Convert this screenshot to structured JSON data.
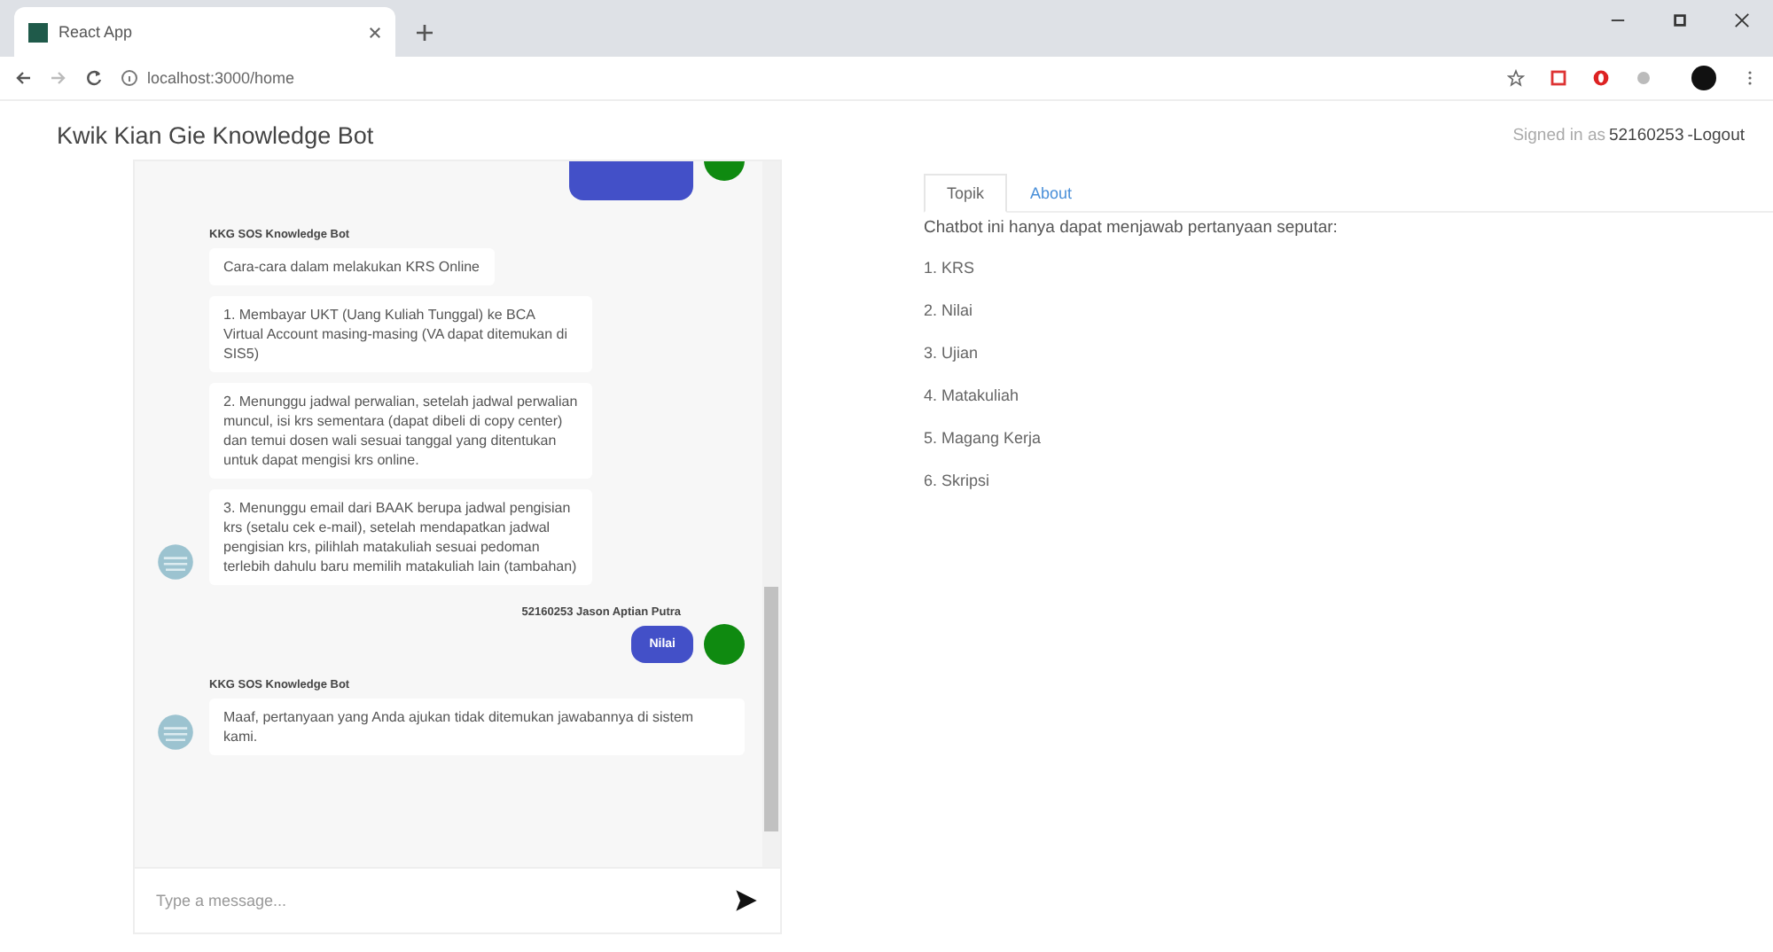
{
  "browser": {
    "tab_title": "React App",
    "url": "localhost:3000/home"
  },
  "header": {
    "title": "Kwik Kian Gie Knowledge Bot",
    "signed_in_label": "Signed in as",
    "user_id": "52160253",
    "logout": "-Logout"
  },
  "chat": {
    "messages": [
      {
        "kind": "cut_user"
      },
      {
        "kind": "bot",
        "sender": "KKG SOS Knowledge Bot",
        "bubbles": [
          "Cara-cara dalam melakukan KRS Online",
          "1. Membayar UKT (Uang Kuliah Tunggal) ke BCA Virtual Account masing-masing (VA dapat ditemukan di SIS5)",
          "2. Menunggu jadwal perwalian, setelah jadwal perwalian muncul, isi krs sementara (dapat dibeli di copy center) dan temui dosen wali sesuai tanggal yang ditentukan untuk dapat mengisi krs online.",
          "3. Menunggu email dari BAAK berupa jadwal pengisian krs (setalu cek e-mail), setelah mendapatkan jadwal pengisian krs, pilihlah matakuliah sesuai pedoman terlebih dahulu baru memilih matakuliah lain (tambahan)"
        ]
      },
      {
        "kind": "user",
        "sender": "52160253 Jason Aptian Putra",
        "bubbles": [
          "Nilai"
        ]
      },
      {
        "kind": "bot",
        "sender": "KKG SOS Knowledge Bot",
        "bubbles": [
          "Maaf, pertanyaan yang Anda ajukan tidak ditemukan jawabannya di sistem kami."
        ]
      }
    ],
    "input": {
      "placeholder": "Type a message..."
    }
  },
  "tabs": [
    {
      "label": "Topik",
      "selected": true
    },
    {
      "label": "About",
      "selected": false
    }
  ],
  "topics": {
    "intro": "Chatbot ini hanya dapat menjawab pertanyaan seputar:",
    "items": [
      "1. KRS",
      "2. Nilai",
      "3. Ujian",
      "4. Matakuliah",
      "5. Magang Kerja",
      "6. Skripsi"
    ]
  }
}
